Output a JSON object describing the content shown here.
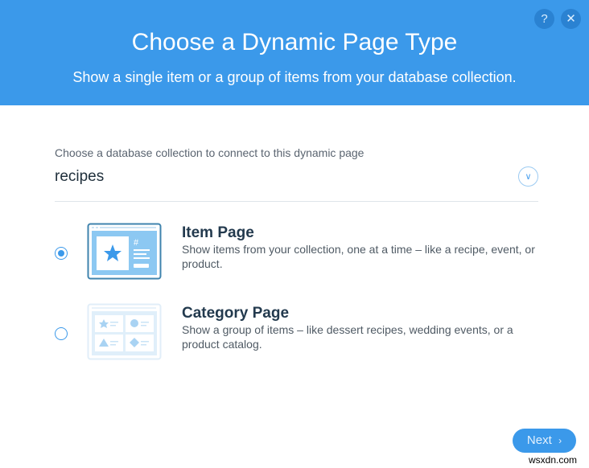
{
  "header": {
    "title": "Choose a Dynamic Page Type",
    "subtitle": "Show a single item or a group of items from your database collection.",
    "help_icon": "?",
    "close_icon": "✕"
  },
  "collection": {
    "label": "Choose a database collection to connect to this dynamic page",
    "value": "recipes"
  },
  "options": [
    {
      "title": "Item Page",
      "description": "Show items from your collection, one at a time – like a recipe, event, or product.",
      "selected": true
    },
    {
      "title": "Category Page",
      "description": "Show a group of items – like dessert recipes, wedding events, or a product catalog.",
      "selected": false
    }
  ],
  "footer": {
    "next_label": "Next",
    "next_icon": "›"
  },
  "watermark": "wsxdn.com",
  "colors": {
    "accent": "#3b99ea",
    "title": "#233a4e"
  }
}
